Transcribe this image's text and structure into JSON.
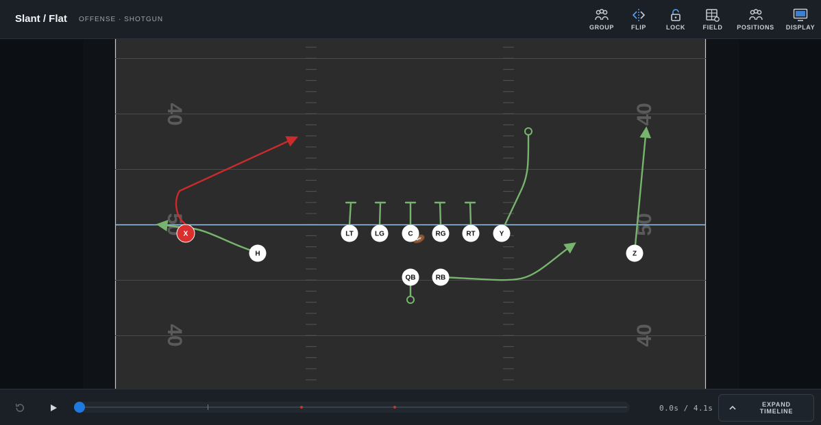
{
  "header": {
    "title": "Slant / Flat",
    "subtitle": "OFFENSE · SHOTGUN"
  },
  "toolbar": {
    "items": [
      {
        "label": "GROUP",
        "icon": "group-icon"
      },
      {
        "label": "FLIP",
        "icon": "flip-icon"
      },
      {
        "label": "LOCK",
        "icon": "lock-icon"
      },
      {
        "label": "FIELD",
        "icon": "field-icon"
      },
      {
        "label": "POSITIONS",
        "icon": "positions-icon"
      },
      {
        "label": "DISPLAY",
        "icon": "display-icon"
      }
    ]
  },
  "field": {
    "yard_numbers": [
      "40",
      "50",
      "40"
    ],
    "colors": {
      "field": "#2c2c2c",
      "line_of_scrimmage": "#9fc3e6",
      "route_default": "#77b46e",
      "route_highlight": "#cc2b2b",
      "player_fill": "#ffffff",
      "player_selected": "#d9302f"
    }
  },
  "players": [
    {
      "id": "X",
      "label": "X",
      "selected": true
    },
    {
      "id": "H",
      "label": "H"
    },
    {
      "id": "LT",
      "label": "LT"
    },
    {
      "id": "LG",
      "label": "LG"
    },
    {
      "id": "C",
      "label": "C"
    },
    {
      "id": "RG",
      "label": "RG"
    },
    {
      "id": "RT",
      "label": "RT"
    },
    {
      "id": "Y",
      "label": "Y"
    },
    {
      "id": "Z",
      "label": "Z"
    },
    {
      "id": "QB",
      "label": "QB"
    },
    {
      "id": "RB",
      "label": "RB"
    }
  ],
  "timeline": {
    "current_time": "0.0s",
    "total_time": "4.1s",
    "time_readout": "0.0s / 4.1s",
    "expand_label_1": "EXPAND",
    "expand_label_2": "TIMELINE",
    "progress": 0.0
  }
}
